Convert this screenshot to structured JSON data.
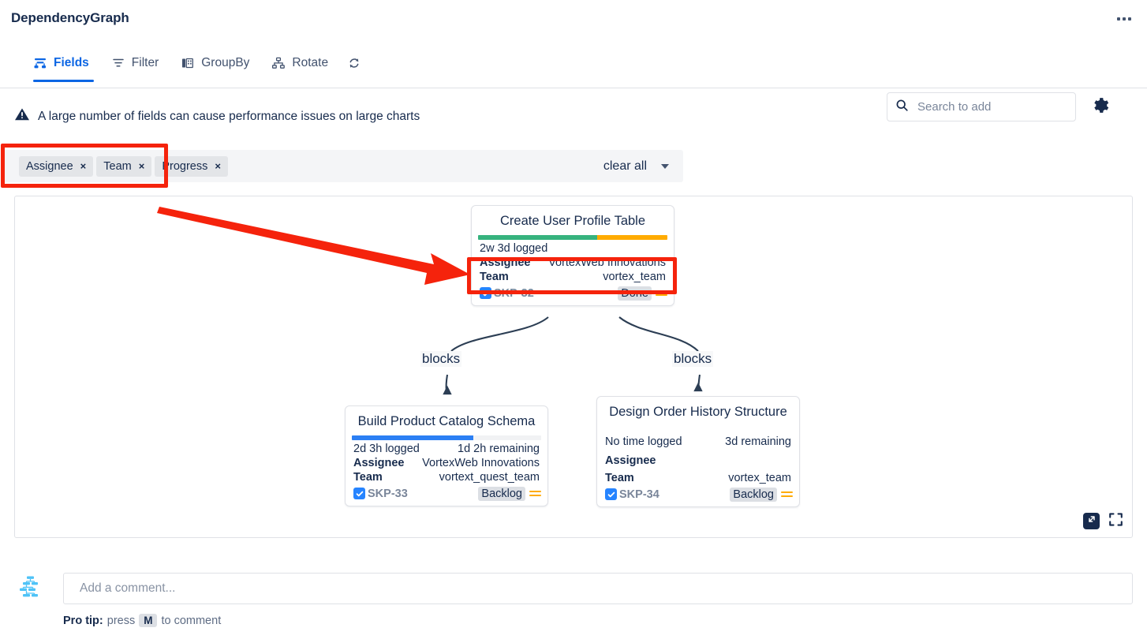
{
  "header": {
    "title": "DependencyGraph",
    "more_menu": "more-options"
  },
  "toolbar": {
    "tabs": [
      {
        "label": "Fields",
        "icon": "fields-icon",
        "active": true
      },
      {
        "label": "Filter",
        "icon": "filter-icon",
        "active": false
      },
      {
        "label": "GroupBy",
        "icon": "groupby-icon",
        "active": false
      },
      {
        "label": "Rotate",
        "icon": "rotate-icon",
        "active": false
      }
    ],
    "refresh_icon": "refresh-icon",
    "search": {
      "value": "",
      "placeholder": "Search to add",
      "icon": "search-icon"
    },
    "settings_icon": "gear-icon"
  },
  "warning": {
    "icon": "warning-icon",
    "text": "A large number of fields can cause performance issues on large charts"
  },
  "fields_bar": {
    "chips": [
      {
        "label": "Assignee",
        "remove": "×"
      },
      {
        "label": "Team",
        "remove": "×"
      },
      {
        "label": "Progress",
        "remove": "×"
      }
    ],
    "clear_all_label": "clear all",
    "dropdown_icon": "chevron-down-icon"
  },
  "graph": {
    "nodes": [
      {
        "id": "SKP-32",
        "title": "Create User Profile Table",
        "progress": {
          "segments": [
            {
              "color": "#36B37E",
              "pct": 63
            },
            {
              "color": "#FFAB00",
              "pct": 37
            }
          ]
        },
        "time_logged": "2w 3d logged",
        "time_remaining": "",
        "fields": [
          {
            "key": "Assignee",
            "value": "VortexWeb Innovations"
          },
          {
            "key": "Team",
            "value": "vortex_team"
          }
        ],
        "status": "Done",
        "priority": "Medium",
        "checkbox": "checked"
      },
      {
        "id": "SKP-33",
        "title": "Build Product Catalog Schema",
        "progress": {
          "segments": [
            {
              "color": "#2B7FF4",
              "pct": 64
            }
          ]
        },
        "time_logged": "2d 3h logged",
        "time_remaining": "1d 2h remaining",
        "fields": [
          {
            "key": "Assignee",
            "value": "VortexWeb Innovations"
          },
          {
            "key": "Team",
            "value": "vortext_quest_team"
          }
        ],
        "status": "Backlog",
        "priority": "Medium",
        "checkbox": "checked"
      },
      {
        "id": "SKP-34",
        "title": "Design Order History Structure",
        "progress": null,
        "time_logged": "No time logged",
        "time_remaining": "3d remaining",
        "fields": [
          {
            "key": "Assignee",
            "value": ""
          },
          {
            "key": "Team",
            "value": "vortex_team"
          }
        ],
        "status": "Backlog",
        "priority": "Medium",
        "checkbox": "checked"
      }
    ],
    "edges": [
      {
        "from": "SKP-32",
        "to": "SKP-33",
        "label": "blocks"
      },
      {
        "from": "SKP-32",
        "to": "SKP-34",
        "label": "blocks"
      }
    ],
    "controls": {
      "expand_icon": "expand-diagonal-icon",
      "fullscreen_icon": "fullscreen-icon"
    }
  },
  "comment": {
    "avatar_icon": "org-chart-avatar-icon",
    "value": "",
    "placeholder": "Add a comment...",
    "protip_prefix": "Pro tip:",
    "protip_press": "press",
    "protip_key": "M",
    "protip_suffix": "to comment"
  },
  "annotations": {
    "accent_color": "#F5230C",
    "chips_highlight": "Assignee and Team chips highlighted",
    "fields_highlight": "Assignee and Team rows highlighted",
    "arrow": "red-arrow-pointing-to-node-fields"
  }
}
